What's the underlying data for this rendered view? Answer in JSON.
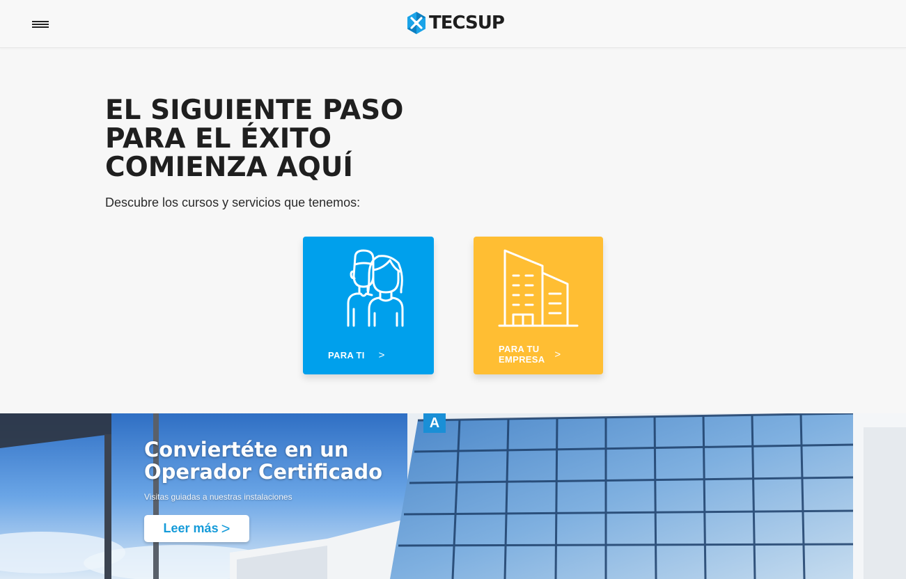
{
  "header": {
    "brand": "TECSUP"
  },
  "hero": {
    "title_lines": [
      "EL SIGUIENTE PASO",
      "PARA EL ÉXITO",
      "COMIENZA AQUÍ"
    ],
    "subtitle": "Descubre los cursos y servicios que tenemos:"
  },
  "cards": [
    {
      "label_lines": [
        "PARA TI"
      ],
      "arrow": ">",
      "color": "#00a0ec",
      "icon": "people-icon"
    },
    {
      "label_lines": [
        "PARA TU",
        "EMPRESA"
      ],
      "arrow": ">",
      "color": "#ffbe33",
      "icon": "building-icon"
    }
  ],
  "banner": {
    "title_lines": [
      "Conviertéte en un",
      "Operador Certificado"
    ],
    "subtitle": "Visitas guiadas a nuestras instalaciones",
    "button_label": "Leer más",
    "button_arrow": ">",
    "sign_letter": "A"
  },
  "colors": {
    "accent_blue": "#00a0ec",
    "accent_yellow": "#ffbe33",
    "logo_blue": "#1aa3e8"
  }
}
